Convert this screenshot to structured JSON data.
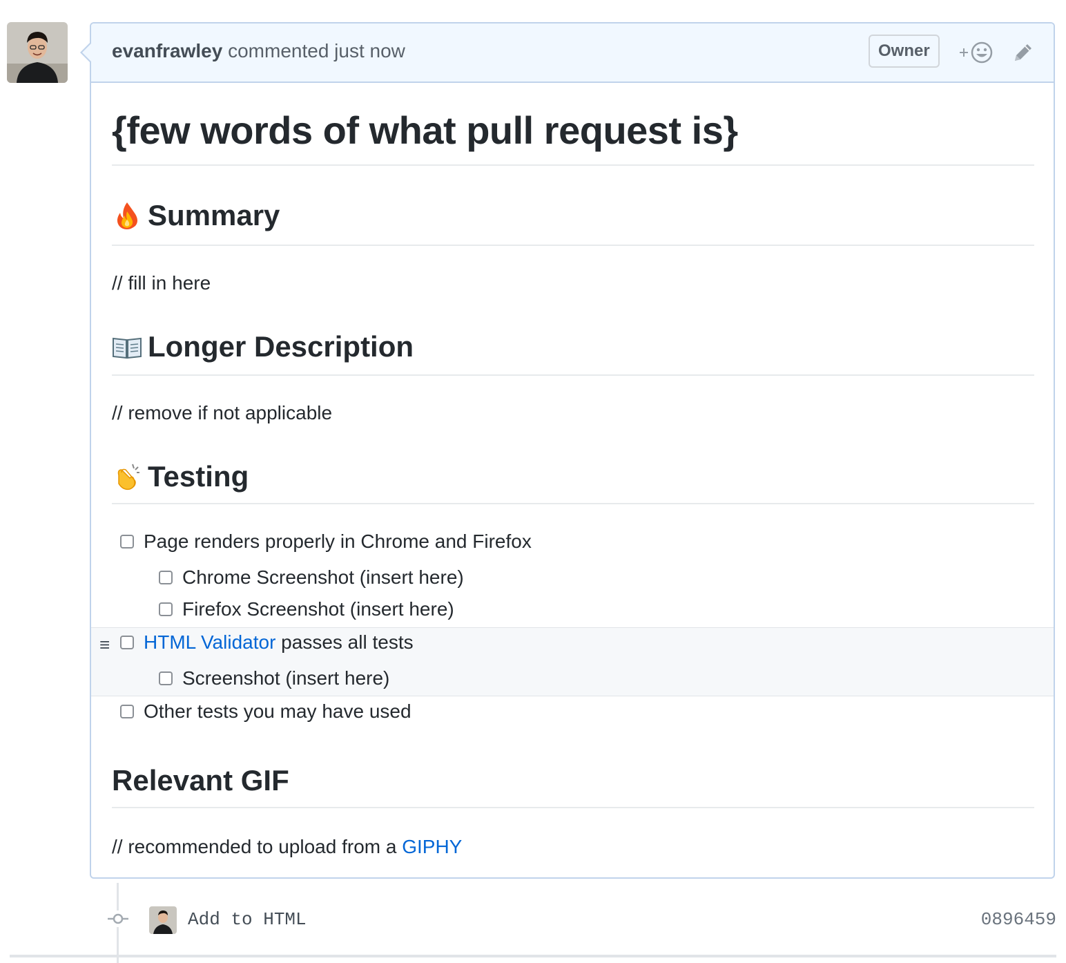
{
  "comment": {
    "author": "evanfrawley",
    "action": "commented just now",
    "badge": "Owner",
    "reaction_plus": "+"
  },
  "body": {
    "title": "{few words of what pull request is}",
    "summary_heading": "Summary",
    "summary_text": "// fill in here",
    "description_heading": "Longer Description",
    "description_text": "// remove if not applicable",
    "testing_heading": "Testing",
    "tasks": [
      {
        "label": "Page renders properly in Chrome and Firefox",
        "checked": false
      },
      {
        "label": "Chrome Screenshot (insert here)",
        "checked": false
      },
      {
        "label": "Firefox Screenshot (insert here)",
        "checked": false
      },
      {
        "link_text": "HTML Validator",
        "label": " passes all tests",
        "checked": false
      },
      {
        "label": "Screenshot (insert here)",
        "checked": false
      },
      {
        "label": "Other tests you may have used",
        "checked": false
      }
    ],
    "gif_heading": "Relevant GIF",
    "gif_text_prefix": "// recommended to upload from a ",
    "gif_link": "GIPHY"
  },
  "commit": {
    "message": "Add to HTML",
    "sha": "0896459"
  },
  "icons": {
    "summary": "fire-emoji",
    "description": "open-book-emoji",
    "testing": "clapping-hands-emoji",
    "drag": "drag-handle-icon"
  },
  "colors": {
    "link": "#0366d6",
    "header_bg": "#f1f8ff",
    "border": "#c0d3eb"
  }
}
